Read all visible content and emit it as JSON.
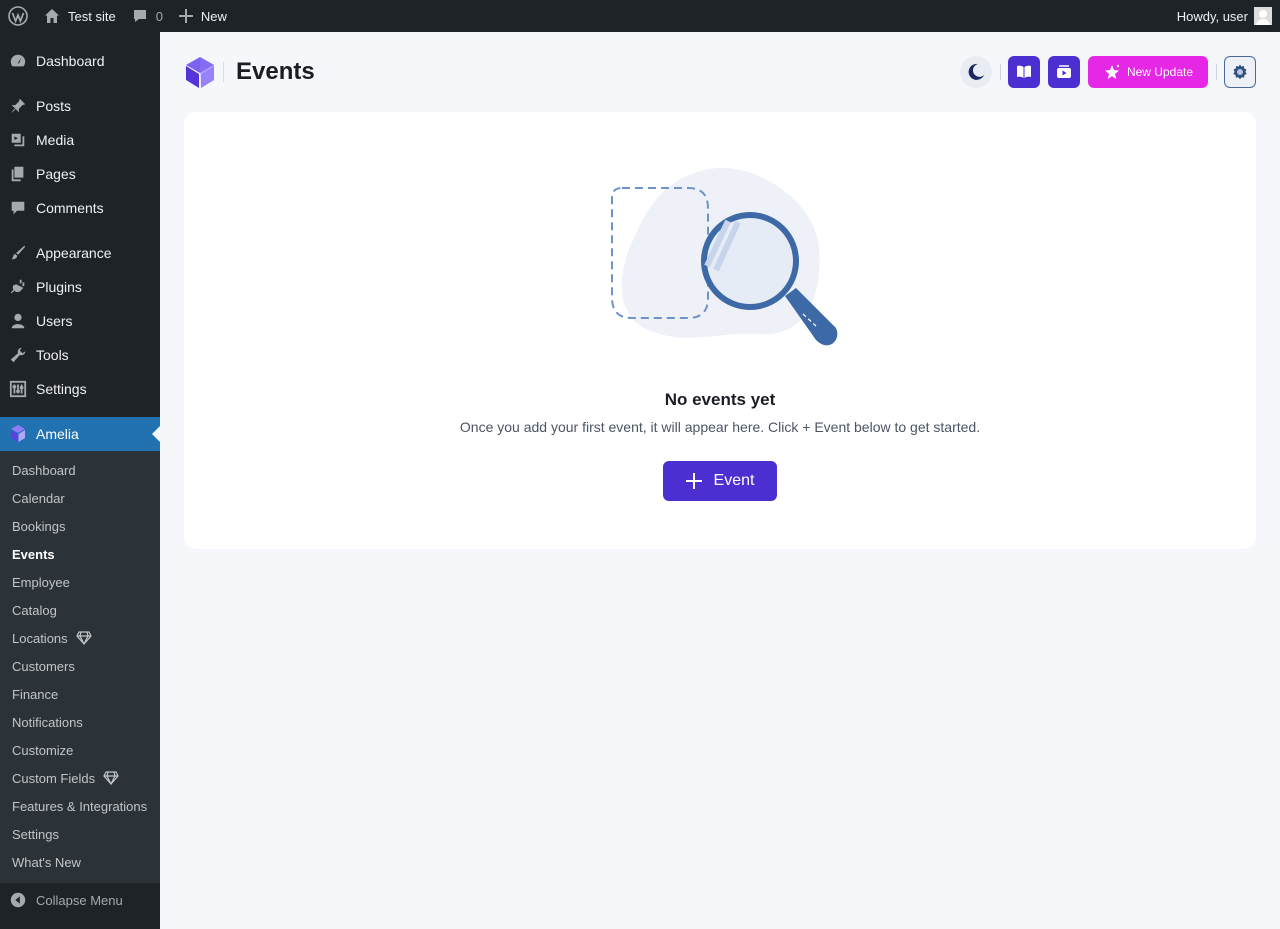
{
  "adminbar": {
    "site_name": "Test site",
    "comments_count": "0",
    "new_label": "New",
    "greeting": "Howdy, user"
  },
  "sidebar": {
    "items": [
      {
        "label": "Dashboard",
        "icon": "dashboard-icon"
      },
      {
        "label": "Posts",
        "icon": "pin-icon"
      },
      {
        "label": "Media",
        "icon": "media-icon"
      },
      {
        "label": "Pages",
        "icon": "pages-icon"
      },
      {
        "label": "Comments",
        "icon": "comment-icon"
      },
      {
        "label": "Appearance",
        "icon": "brush-icon"
      },
      {
        "label": "Plugins",
        "icon": "plug-icon"
      },
      {
        "label": "Users",
        "icon": "user-icon"
      },
      {
        "label": "Tools",
        "icon": "wrench-icon"
      },
      {
        "label": "Settings",
        "icon": "sliders-icon"
      },
      {
        "label": "Amelia",
        "icon": "amelia-icon"
      }
    ],
    "submenu": [
      "Dashboard",
      "Calendar",
      "Bookings",
      "Events",
      "Employee",
      "Catalog",
      "Locations",
      "Customers",
      "Finance",
      "Notifications",
      "Customize",
      "Custom Fields",
      "Features & Integrations",
      "Settings",
      "What's New"
    ],
    "current_submenu": "Events",
    "collapse_label": "Collapse Menu"
  },
  "header": {
    "title": "Events",
    "update_label": "New Update"
  },
  "empty_state": {
    "title": "No events yet",
    "description": "Once you add your first event, it will appear here. Click + Event below to get started.",
    "button_label": "Event"
  },
  "colors": {
    "primary": "#4b2fd1",
    "update": "#e628e6",
    "wp_active": "#2271b1"
  }
}
